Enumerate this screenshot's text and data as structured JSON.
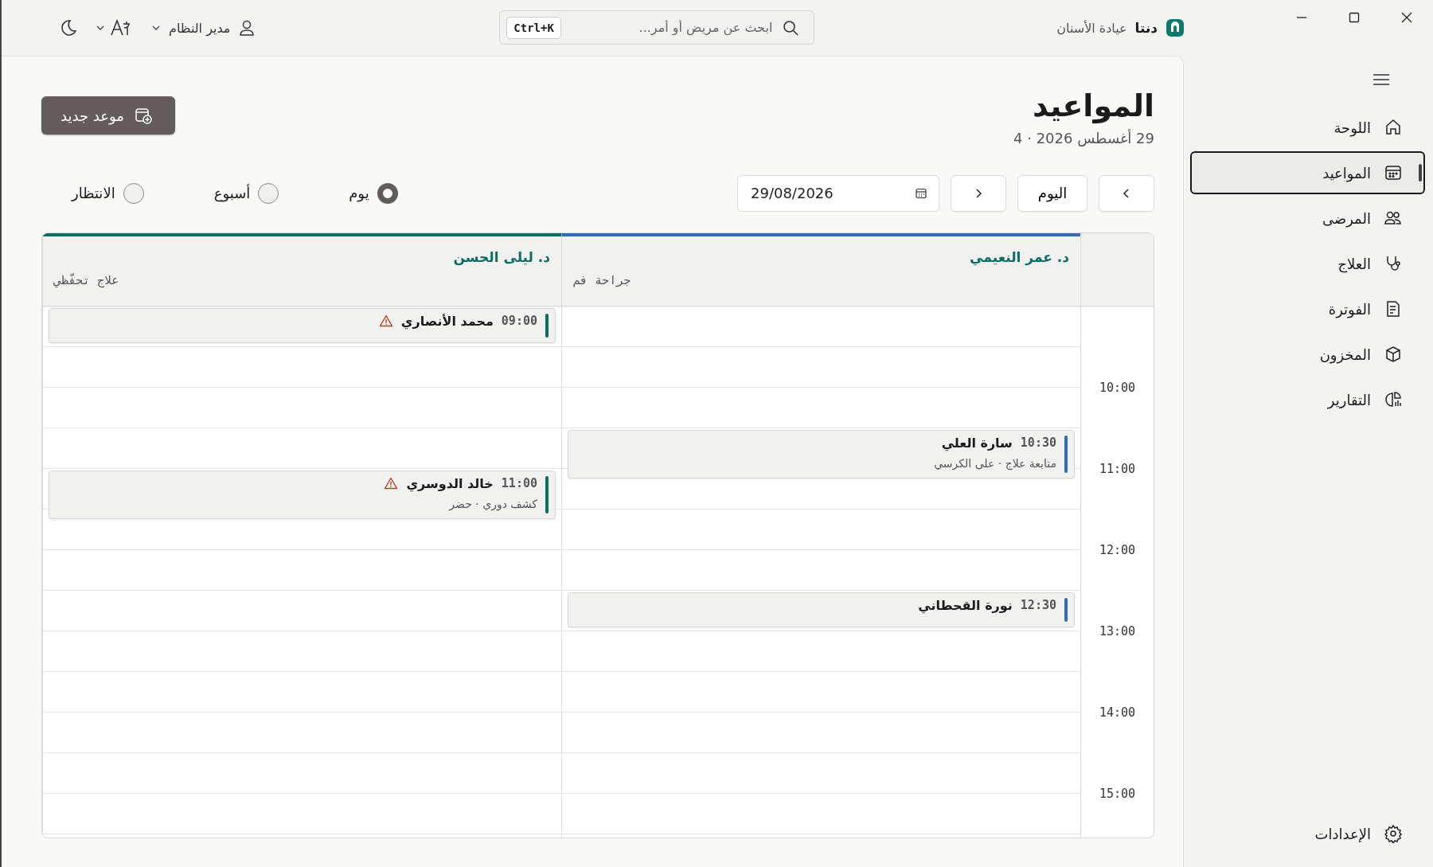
{
  "brand": {
    "name": "دنتا",
    "subtitle": "عيادة الأسنان"
  },
  "search": {
    "placeholder": "ابحث عن مريض أو أمر...",
    "shortcut": "Ctrl+K"
  },
  "user": {
    "name": "مدير النظام"
  },
  "sidebar": {
    "items": [
      {
        "label": "اللوحة",
        "selected": false
      },
      {
        "label": "المواعيد",
        "selected": true
      },
      {
        "label": "المرضى",
        "selected": false
      },
      {
        "label": "العلاج",
        "selected": false
      },
      {
        "label": "الفوترة",
        "selected": false
      },
      {
        "label": "المخزون",
        "selected": false
      },
      {
        "label": "التقارير",
        "selected": false
      }
    ],
    "footer_item": {
      "label": "الإعدادات",
      "selected": false
    }
  },
  "page": {
    "title": "المواعيد",
    "subtitle": "29 أغسطس 2026 · 4",
    "new_button": "موعد جديد"
  },
  "toolbar": {
    "today_button": "اليوم",
    "date": "29/08/2026"
  },
  "views": [
    {
      "label": "يوم",
      "selected": true
    },
    {
      "label": "أسبوع",
      "selected": false
    },
    {
      "label": "الانتظار",
      "selected": false
    }
  ],
  "calendar": {
    "hours": [
      "10:00",
      "11:00",
      "12:00",
      "13:00",
      "14:00",
      "15:00"
    ],
    "doctors": [
      {
        "name": "د. عمر النعيمي",
        "specialty": "جراحة فم",
        "color": "#2f6db5",
        "slots": [
          {
            "booked": false
          },
          {
            "booked": false
          },
          {
            "booked": false
          },
          {
            "booked": true,
            "time": "10:30",
            "patient": "سارة العلي",
            "warning": false,
            "detail": "متابعة علاج · على الكرسي"
          },
          {
            "booked": false
          },
          {
            "booked": false
          },
          {
            "booked": false
          },
          {
            "booked": true,
            "time": "12:30",
            "patient": "نورة القحطاني",
            "warning": false
          },
          {
            "booked": false
          },
          {
            "booked": false
          },
          {
            "booked": false
          },
          {
            "booked": false
          },
          {
            "booked": false
          }
        ]
      },
      {
        "name": "د. ليلى الحسن",
        "specialty": "علاج تحفّظي",
        "color": "#0f6e64",
        "slots": [
          {
            "booked": true,
            "time": "09:00",
            "patient": "محمد الأنصاري",
            "warning": true
          },
          {
            "booked": false
          },
          {
            "booked": false
          },
          {
            "booked": false
          },
          {
            "booked": true,
            "time": "11:00",
            "patient": "خالد الدوسري",
            "warning": true,
            "detail": "كشف دوري · حضر"
          },
          {
            "booked": false
          },
          {
            "booked": false
          },
          {
            "booked": false
          },
          {
            "booked": false
          },
          {
            "booked": false
          },
          {
            "booked": false
          },
          {
            "booked": false
          },
          {
            "booked": false
          }
        ]
      }
    ]
  }
}
